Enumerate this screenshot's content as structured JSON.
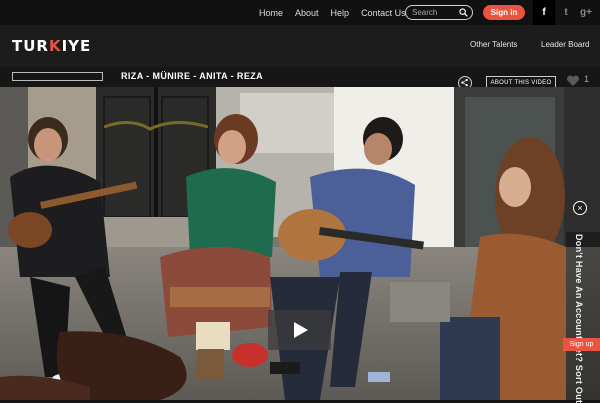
{
  "top_nav": {
    "home": "Home",
    "about": "About",
    "help": "Help",
    "contact": "Contact Us"
  },
  "search": {
    "placeholder": "Search"
  },
  "signin_label": "Sign in",
  "social": {
    "facebook": "f",
    "tumblr": "t",
    "googleplus": "g+"
  },
  "logo": {
    "part1": "TUR",
    "k": "K",
    "part2": "IYE"
  },
  "header_nav": {
    "other_talents": "Other Talents",
    "leader_board": "Leader Board"
  },
  "video": {
    "title": "RIZA - MÜNIRE - ANITA - REZA",
    "about_label": "ABOUT THIS VIDEO",
    "likes": "1"
  },
  "overlay": {
    "prompt": "Don't Have An Account Yet? Sort Out",
    "close_symbol": "×",
    "signup_label": "Sign up"
  },
  "colors": {
    "accent": "#e8543f",
    "background": "#161616"
  }
}
